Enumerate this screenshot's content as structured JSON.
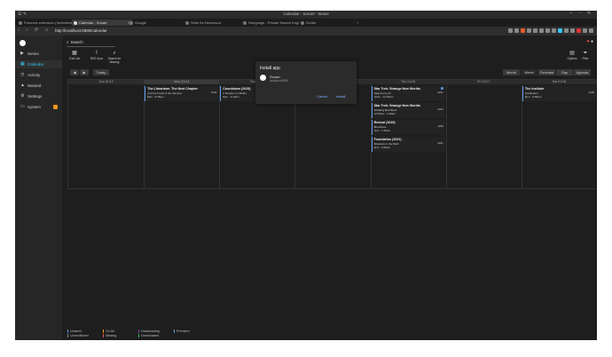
{
  "window": {
    "title": "Calendar - Sonarr - Brave"
  },
  "tabs": [
    {
      "label": "Proxmox extension (Verlinkten)",
      "active": false
    },
    {
      "label": "Calendar - Sonarr",
      "active": true
    },
    {
      "label": "Google",
      "active": false
    },
    {
      "label": "Seite für Nextcloud",
      "active": false
    },
    {
      "label": "Storypage - Private Search Engi",
      "active": false
    },
    {
      "label": "Scribe",
      "active": false
    }
  ],
  "urlbar": {
    "url": "http://localhost:8989/calendar"
  },
  "sidebar": {
    "items": [
      {
        "icon": "play-icon",
        "label": "Series",
        "active": false
      },
      {
        "icon": "calendar-icon",
        "label": "Calendar",
        "active": true
      },
      {
        "icon": "clock-icon",
        "label": "Activity",
        "active": false
      },
      {
        "icon": "warning-icon",
        "label": "Wanted",
        "active": false
      },
      {
        "icon": "wrench-icon",
        "label": "Settings",
        "active": false
      },
      {
        "icon": "monitor-icon",
        "label": "System",
        "active": false
      }
    ]
  },
  "search": {
    "label": "Search"
  },
  "toolbar": {
    "ical": "iCal Link",
    "rss": "RSS Sync",
    "search_missing": "Search for Missing",
    "options": "Options",
    "filter": "Filter"
  },
  "controls": {
    "prev": "◀",
    "next": "▶",
    "today": "Today"
  },
  "views": [
    "Month",
    "Week",
    "Forecast",
    "Day",
    "Agenda"
  ],
  "days": [
    {
      "label": "Sun 01/12",
      "today": false,
      "events": []
    },
    {
      "label": "Mon 01/13",
      "today": true,
      "events": [
        {
          "title": "The Librarians: The Next Chapter",
          "subtitle": "And the Feast of the Vampire",
          "time": "8pm - 8:45pm",
          "episode": "1x09",
          "premiere": false
        }
      ]
    },
    {
      "label": "Tue 01/14",
      "today": false,
      "events": [
        {
          "title": "Countdown (2025)",
          "subtitle": "A Needle or a Bullet",
          "time": "8pm - 9:10pm",
          "episode": "1x06",
          "premiere": false
        }
      ]
    },
    {
      "label": "Wed 01/15",
      "today": false,
      "events": []
    },
    {
      "label": "Thu 01/16",
      "today": false,
      "events": [
        {
          "title": "Star Trek: Strange New Worlds",
          "subtitle": "Hegemony (2)",
          "time": "12am - 12:54am",
          "episode": "3x01",
          "premiere": true
        },
        {
          "title": "Star Trek: Strange New Worlds",
          "subtitle": "Wedding Bell Blues",
          "time": "12:54am - 1:49am",
          "episode": "3x02",
          "premiere": false
        },
        {
          "title": "Revival (2025)",
          "subtitle": "Bloodlines",
          "time": "7pm - 7:45pm",
          "episode": "1x06",
          "premiere": false
        },
        {
          "title": "Foundation (2021)",
          "subtitle": "Shadows in the Math",
          "time": "9pm - 9:59pm",
          "episode": "3x01",
          "premiere": false
        }
      ]
    },
    {
      "label": "Fri 01/17",
      "today": false,
      "events": []
    },
    {
      "label": "Sat 01/18",
      "today": false,
      "events": [
        {
          "title": "The Institute",
          "subtitle": "Graduation",
          "time": "9pm - 9:55pm",
          "episode": "1x08",
          "premiere": false
        }
      ]
    }
  ],
  "install_dialog": {
    "heading": "Install app",
    "app_name": "Sonarr",
    "app_url": "localhost:8989",
    "cancel": "Cancel",
    "install": "Install"
  },
  "legend": [
    {
      "label": "Unaired",
      "color": "#5d9cec"
    },
    {
      "label": "Unmonitored",
      "color": "#888888"
    },
    {
      "label": "On Air",
      "color": "#f0961b"
    },
    {
      "label": "Missing",
      "color": "#f05050"
    },
    {
      "label": "Downloading",
      "color": "#7a43b6"
    },
    {
      "label": "Downloaded",
      "color": "#27c24c"
    },
    {
      "label": "Premiere",
      "color": "#5d9cec"
    }
  ],
  "colors": {
    "accent": "#35c5f4",
    "warning": "#f0961b",
    "event_border": "#5d9cec"
  }
}
